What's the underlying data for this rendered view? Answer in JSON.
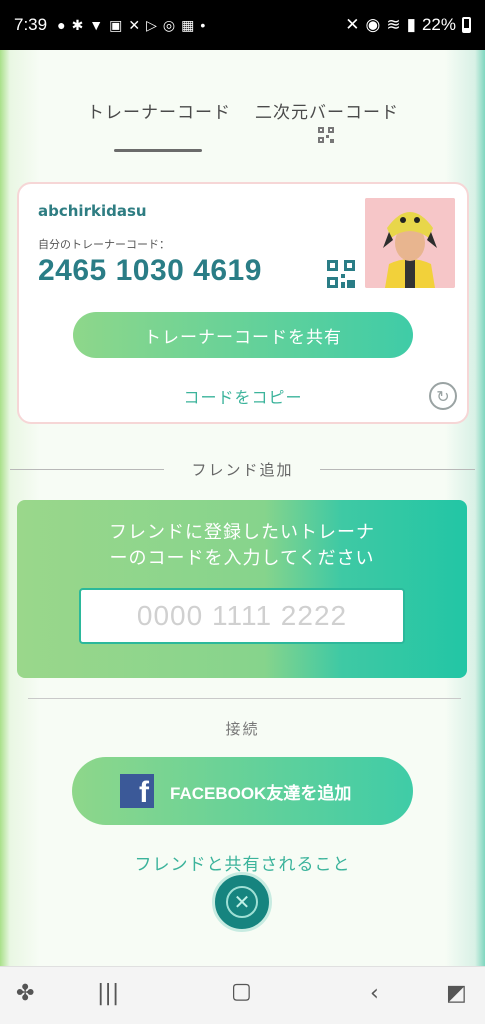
{
  "status_bar": {
    "time": "7:39",
    "battery": "22%"
  },
  "tabs": [
    {
      "label": "トレーナーコード",
      "active": true
    },
    {
      "label": "二次元バーコード",
      "active": false
    }
  ],
  "card": {
    "username": "abchirkidasu",
    "code_label": "自分のトレーナーコード：",
    "trainer_code": "2465 1030 4619",
    "share_button": "トレーナーコードを共有",
    "copy_link": "コードをコピー"
  },
  "friend_section": {
    "title": "フレンド追加",
    "instruction_line1": "フレンドに登録したいトレーナ",
    "instruction_line2": "ーのコードを入力してください",
    "input_placeholder": "0000 1111 2222"
  },
  "connect_section": {
    "title": "接続",
    "facebook_button": "FACEBOOK友達を追加",
    "share_note": "フレンドと共有されること"
  },
  "colors": {
    "accent": "#3bb39b",
    "code_text": "#2a7d86",
    "button_gradient_start": "#8ed78a",
    "button_gradient_end": "#3fcca7",
    "facebook": "#3b5998"
  }
}
